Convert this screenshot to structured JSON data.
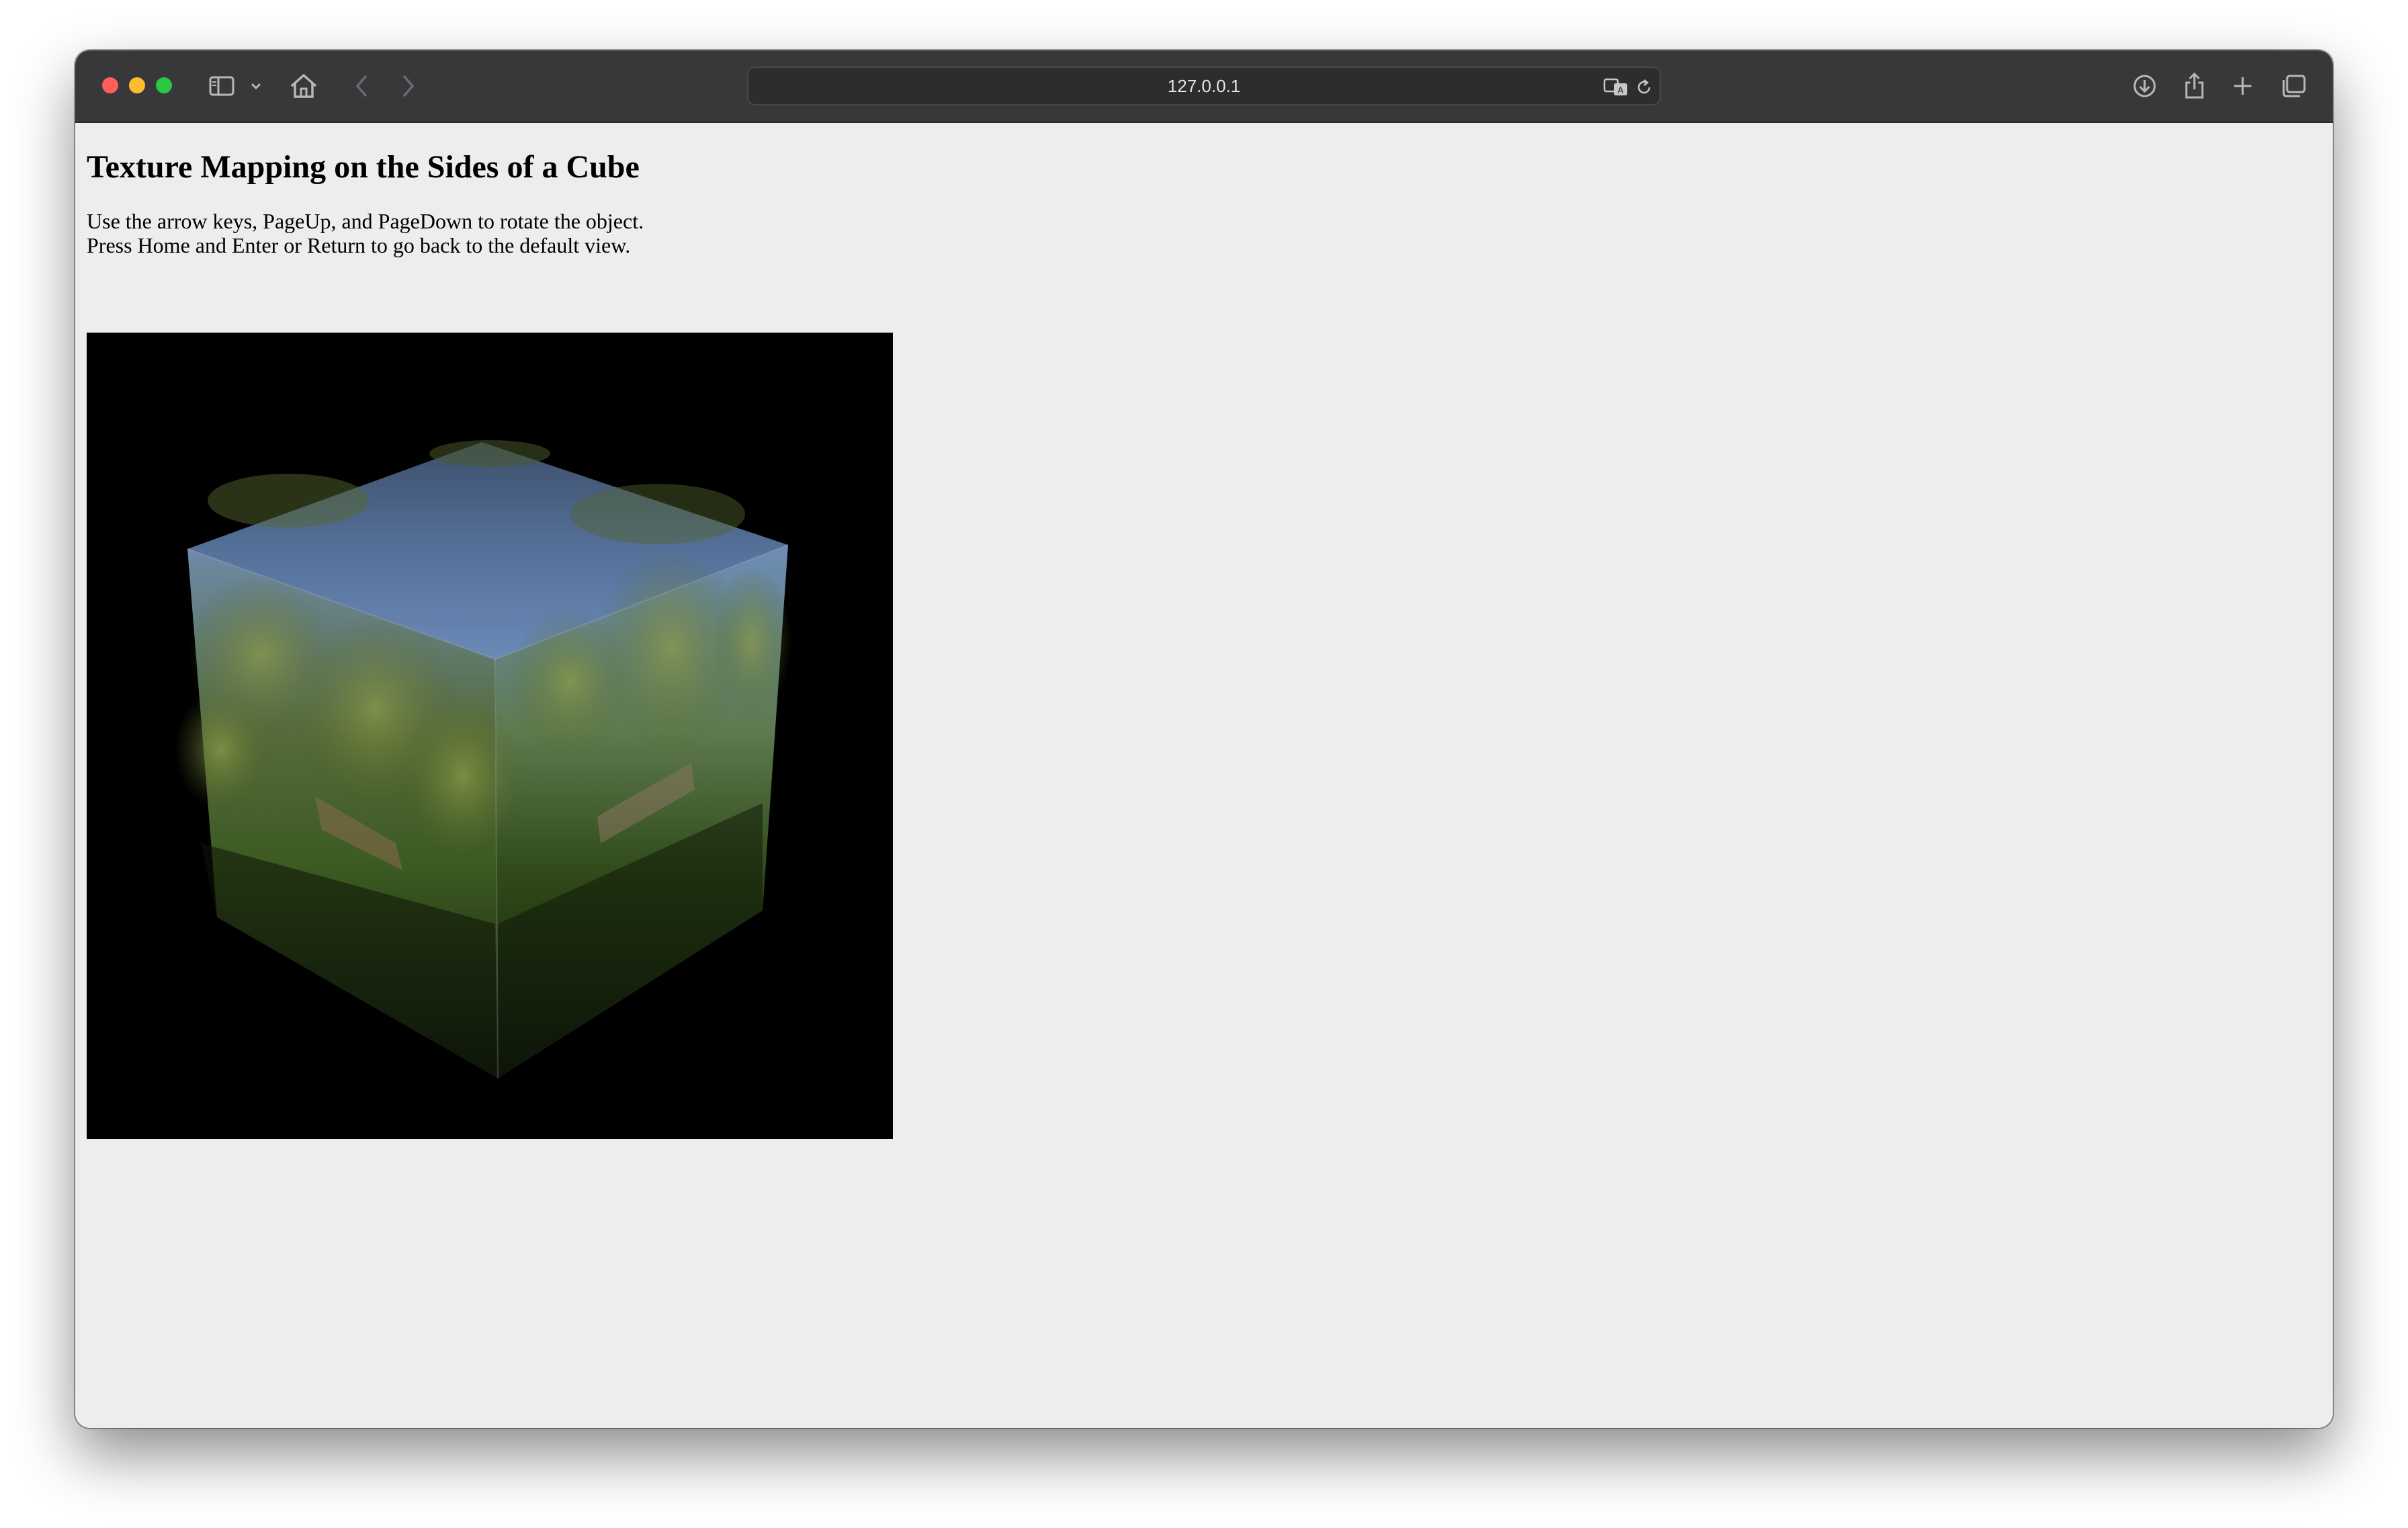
{
  "browser": {
    "address": "127.0.0.1",
    "icons": {
      "sidebar": "sidebar-icon",
      "sidebar_menu": "chevron-down-icon",
      "home": "home-icon",
      "back": "back-arrow-icon",
      "forward": "forward-arrow-icon",
      "translate": "translate-icon",
      "reload": "reload-icon",
      "downloads": "download-icon",
      "share": "share-icon",
      "new_tab": "plus-icon",
      "tab_overview": "tabs-icon"
    },
    "colors": {
      "toolbar": "#38383a",
      "close": "#fe5f57",
      "minimize": "#febc2e",
      "maximize": "#28c840"
    }
  },
  "page": {
    "title": "Texture Mapping on the Sides of a Cube",
    "instructions_line1": "Use the arrow keys, PageUp, and PageDown to rotate the object.",
    "instructions_line2": "Press Home and Enter or Return to go back to the default view.",
    "canvas_background": "#000000"
  }
}
